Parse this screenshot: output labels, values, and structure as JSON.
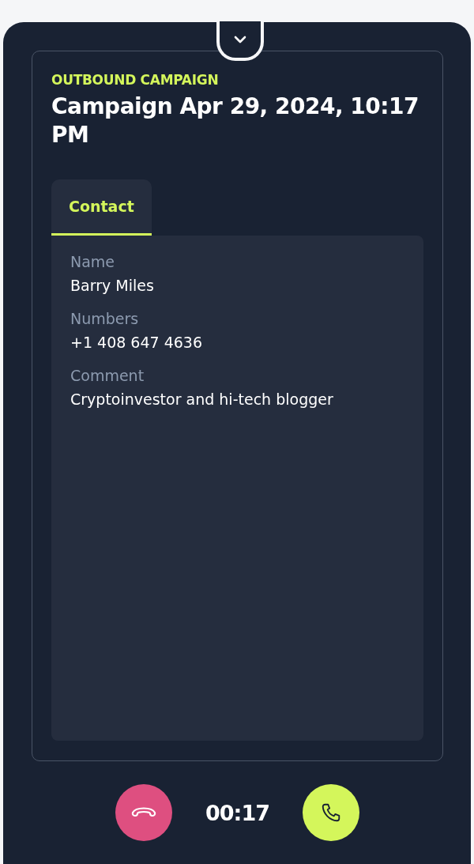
{
  "campaign": {
    "type_label": "OUTBOUND CAMPAIGN",
    "title": "Campaign Apr 29, 2024, 10:17 PM"
  },
  "tabs": [
    {
      "label": "Contact",
      "selected": true
    }
  ],
  "fields": [
    {
      "label": "Name",
      "value": "Barry Miles"
    },
    {
      "label": "Numbers",
      "value": "+1 408 647 4636"
    },
    {
      "label": "Comment",
      "value": "Cryptoinvestor and hi-tech blogger"
    }
  ],
  "call": {
    "timer": "00:17"
  }
}
